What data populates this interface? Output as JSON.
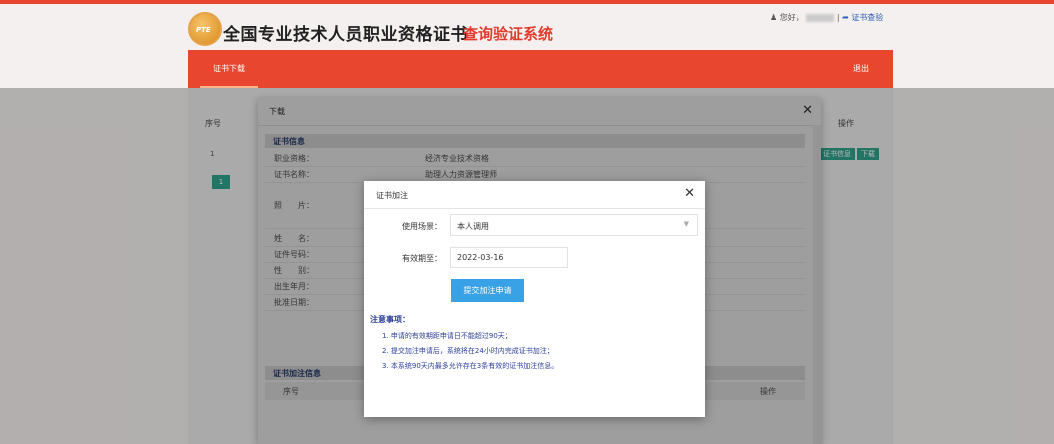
{
  "header": {
    "logo_text": "PTE",
    "title_main": "全国专业技术人员职业资格证书",
    "title_sub": "查询验证系统",
    "greeting": "您好，",
    "separator": "|",
    "verify_link": "证书查验"
  },
  "nav": {
    "tab": "证书下载",
    "exit": "退出"
  },
  "background_table": {
    "col_index": "序号",
    "col_action": "操作",
    "row_index": "1",
    "btn_info": "证书信息",
    "btn_download": "下载",
    "page_num": "1"
  },
  "download_modal": {
    "title": "下载",
    "section_info": "证书信息",
    "rows": [
      {
        "key": "职业资格：",
        "value": "经济专业技术资格"
      },
      {
        "key": "证书名称：",
        "value": "助理人力资源管理师"
      },
      {
        "key": "照　　片：",
        "value": ""
      },
      {
        "key": "姓　　名：",
        "value": ""
      },
      {
        "key": "证件号码：",
        "value": ""
      },
      {
        "key": "性　　别：",
        "value": ""
      },
      {
        "key": "出生年月：",
        "value": ""
      },
      {
        "key": "批准日期：",
        "value": ""
      }
    ],
    "section_annotations": "证书加注信息",
    "sub_col_index": "序号",
    "sub_col_action": "操作"
  },
  "annotation_modal": {
    "title": "证书加注",
    "scene_label": "使用场景：",
    "scene_value": "本人调用",
    "expiry_label": "有效期至：",
    "expiry_value": "2022-03-16",
    "submit_label": "提交加注申请",
    "notes_title": "注意事项：",
    "notes": [
      "1. 申请的有效期距申请日不能超过90天；",
      "2. 提交加注申请后，系统将在24小时内完成证书加注；",
      "3. 本系统90天内最多允许存在3条有效的证书加注信息。"
    ]
  }
}
